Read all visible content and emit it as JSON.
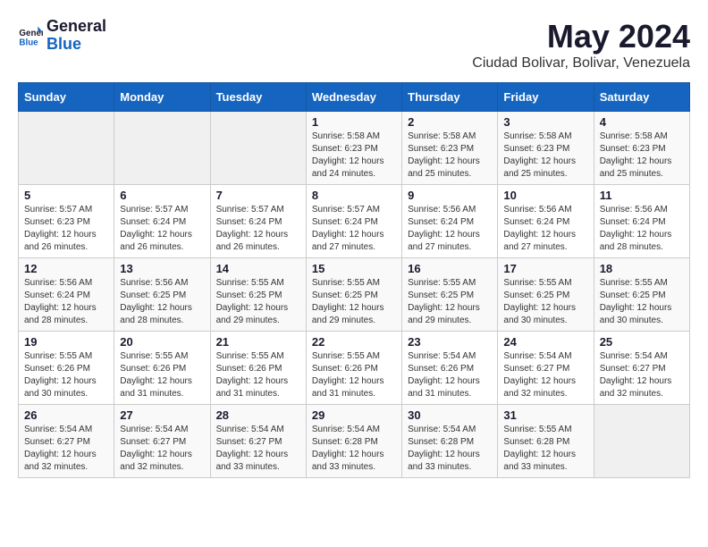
{
  "header": {
    "logo_general": "General",
    "logo_blue": "Blue",
    "month": "May 2024",
    "location": "Ciudad Bolivar, Bolivar, Venezuela"
  },
  "weekdays": [
    "Sunday",
    "Monday",
    "Tuesday",
    "Wednesday",
    "Thursday",
    "Friday",
    "Saturday"
  ],
  "weeks": [
    [
      {
        "day": "",
        "info": ""
      },
      {
        "day": "",
        "info": ""
      },
      {
        "day": "",
        "info": ""
      },
      {
        "day": "1",
        "info": "Sunrise: 5:58 AM\nSunset: 6:23 PM\nDaylight: 12 hours\nand 24 minutes."
      },
      {
        "day": "2",
        "info": "Sunrise: 5:58 AM\nSunset: 6:23 PM\nDaylight: 12 hours\nand 25 minutes."
      },
      {
        "day": "3",
        "info": "Sunrise: 5:58 AM\nSunset: 6:23 PM\nDaylight: 12 hours\nand 25 minutes."
      },
      {
        "day": "4",
        "info": "Sunrise: 5:58 AM\nSunset: 6:23 PM\nDaylight: 12 hours\nand 25 minutes."
      }
    ],
    [
      {
        "day": "5",
        "info": "Sunrise: 5:57 AM\nSunset: 6:23 PM\nDaylight: 12 hours\nand 26 minutes."
      },
      {
        "day": "6",
        "info": "Sunrise: 5:57 AM\nSunset: 6:24 PM\nDaylight: 12 hours\nand 26 minutes."
      },
      {
        "day": "7",
        "info": "Sunrise: 5:57 AM\nSunset: 6:24 PM\nDaylight: 12 hours\nand 26 minutes."
      },
      {
        "day": "8",
        "info": "Sunrise: 5:57 AM\nSunset: 6:24 PM\nDaylight: 12 hours\nand 27 minutes."
      },
      {
        "day": "9",
        "info": "Sunrise: 5:56 AM\nSunset: 6:24 PM\nDaylight: 12 hours\nand 27 minutes."
      },
      {
        "day": "10",
        "info": "Sunrise: 5:56 AM\nSunset: 6:24 PM\nDaylight: 12 hours\nand 27 minutes."
      },
      {
        "day": "11",
        "info": "Sunrise: 5:56 AM\nSunset: 6:24 PM\nDaylight: 12 hours\nand 28 minutes."
      }
    ],
    [
      {
        "day": "12",
        "info": "Sunrise: 5:56 AM\nSunset: 6:24 PM\nDaylight: 12 hours\nand 28 minutes."
      },
      {
        "day": "13",
        "info": "Sunrise: 5:56 AM\nSunset: 6:25 PM\nDaylight: 12 hours\nand 28 minutes."
      },
      {
        "day": "14",
        "info": "Sunrise: 5:55 AM\nSunset: 6:25 PM\nDaylight: 12 hours\nand 29 minutes."
      },
      {
        "day": "15",
        "info": "Sunrise: 5:55 AM\nSunset: 6:25 PM\nDaylight: 12 hours\nand 29 minutes."
      },
      {
        "day": "16",
        "info": "Sunrise: 5:55 AM\nSunset: 6:25 PM\nDaylight: 12 hours\nand 29 minutes."
      },
      {
        "day": "17",
        "info": "Sunrise: 5:55 AM\nSunset: 6:25 PM\nDaylight: 12 hours\nand 30 minutes."
      },
      {
        "day": "18",
        "info": "Sunrise: 5:55 AM\nSunset: 6:25 PM\nDaylight: 12 hours\nand 30 minutes."
      }
    ],
    [
      {
        "day": "19",
        "info": "Sunrise: 5:55 AM\nSunset: 6:26 PM\nDaylight: 12 hours\nand 30 minutes."
      },
      {
        "day": "20",
        "info": "Sunrise: 5:55 AM\nSunset: 6:26 PM\nDaylight: 12 hours\nand 31 minutes."
      },
      {
        "day": "21",
        "info": "Sunrise: 5:55 AM\nSunset: 6:26 PM\nDaylight: 12 hours\nand 31 minutes."
      },
      {
        "day": "22",
        "info": "Sunrise: 5:55 AM\nSunset: 6:26 PM\nDaylight: 12 hours\nand 31 minutes."
      },
      {
        "day": "23",
        "info": "Sunrise: 5:54 AM\nSunset: 6:26 PM\nDaylight: 12 hours\nand 31 minutes."
      },
      {
        "day": "24",
        "info": "Sunrise: 5:54 AM\nSunset: 6:27 PM\nDaylight: 12 hours\nand 32 minutes."
      },
      {
        "day": "25",
        "info": "Sunrise: 5:54 AM\nSunset: 6:27 PM\nDaylight: 12 hours\nand 32 minutes."
      }
    ],
    [
      {
        "day": "26",
        "info": "Sunrise: 5:54 AM\nSunset: 6:27 PM\nDaylight: 12 hours\nand 32 minutes."
      },
      {
        "day": "27",
        "info": "Sunrise: 5:54 AM\nSunset: 6:27 PM\nDaylight: 12 hours\nand 32 minutes."
      },
      {
        "day": "28",
        "info": "Sunrise: 5:54 AM\nSunset: 6:27 PM\nDaylight: 12 hours\nand 33 minutes."
      },
      {
        "day": "29",
        "info": "Sunrise: 5:54 AM\nSunset: 6:28 PM\nDaylight: 12 hours\nand 33 minutes."
      },
      {
        "day": "30",
        "info": "Sunrise: 5:54 AM\nSunset: 6:28 PM\nDaylight: 12 hours\nand 33 minutes."
      },
      {
        "day": "31",
        "info": "Sunrise: 5:55 AM\nSunset: 6:28 PM\nDaylight: 12 hours\nand 33 minutes."
      },
      {
        "day": "",
        "info": ""
      }
    ]
  ]
}
